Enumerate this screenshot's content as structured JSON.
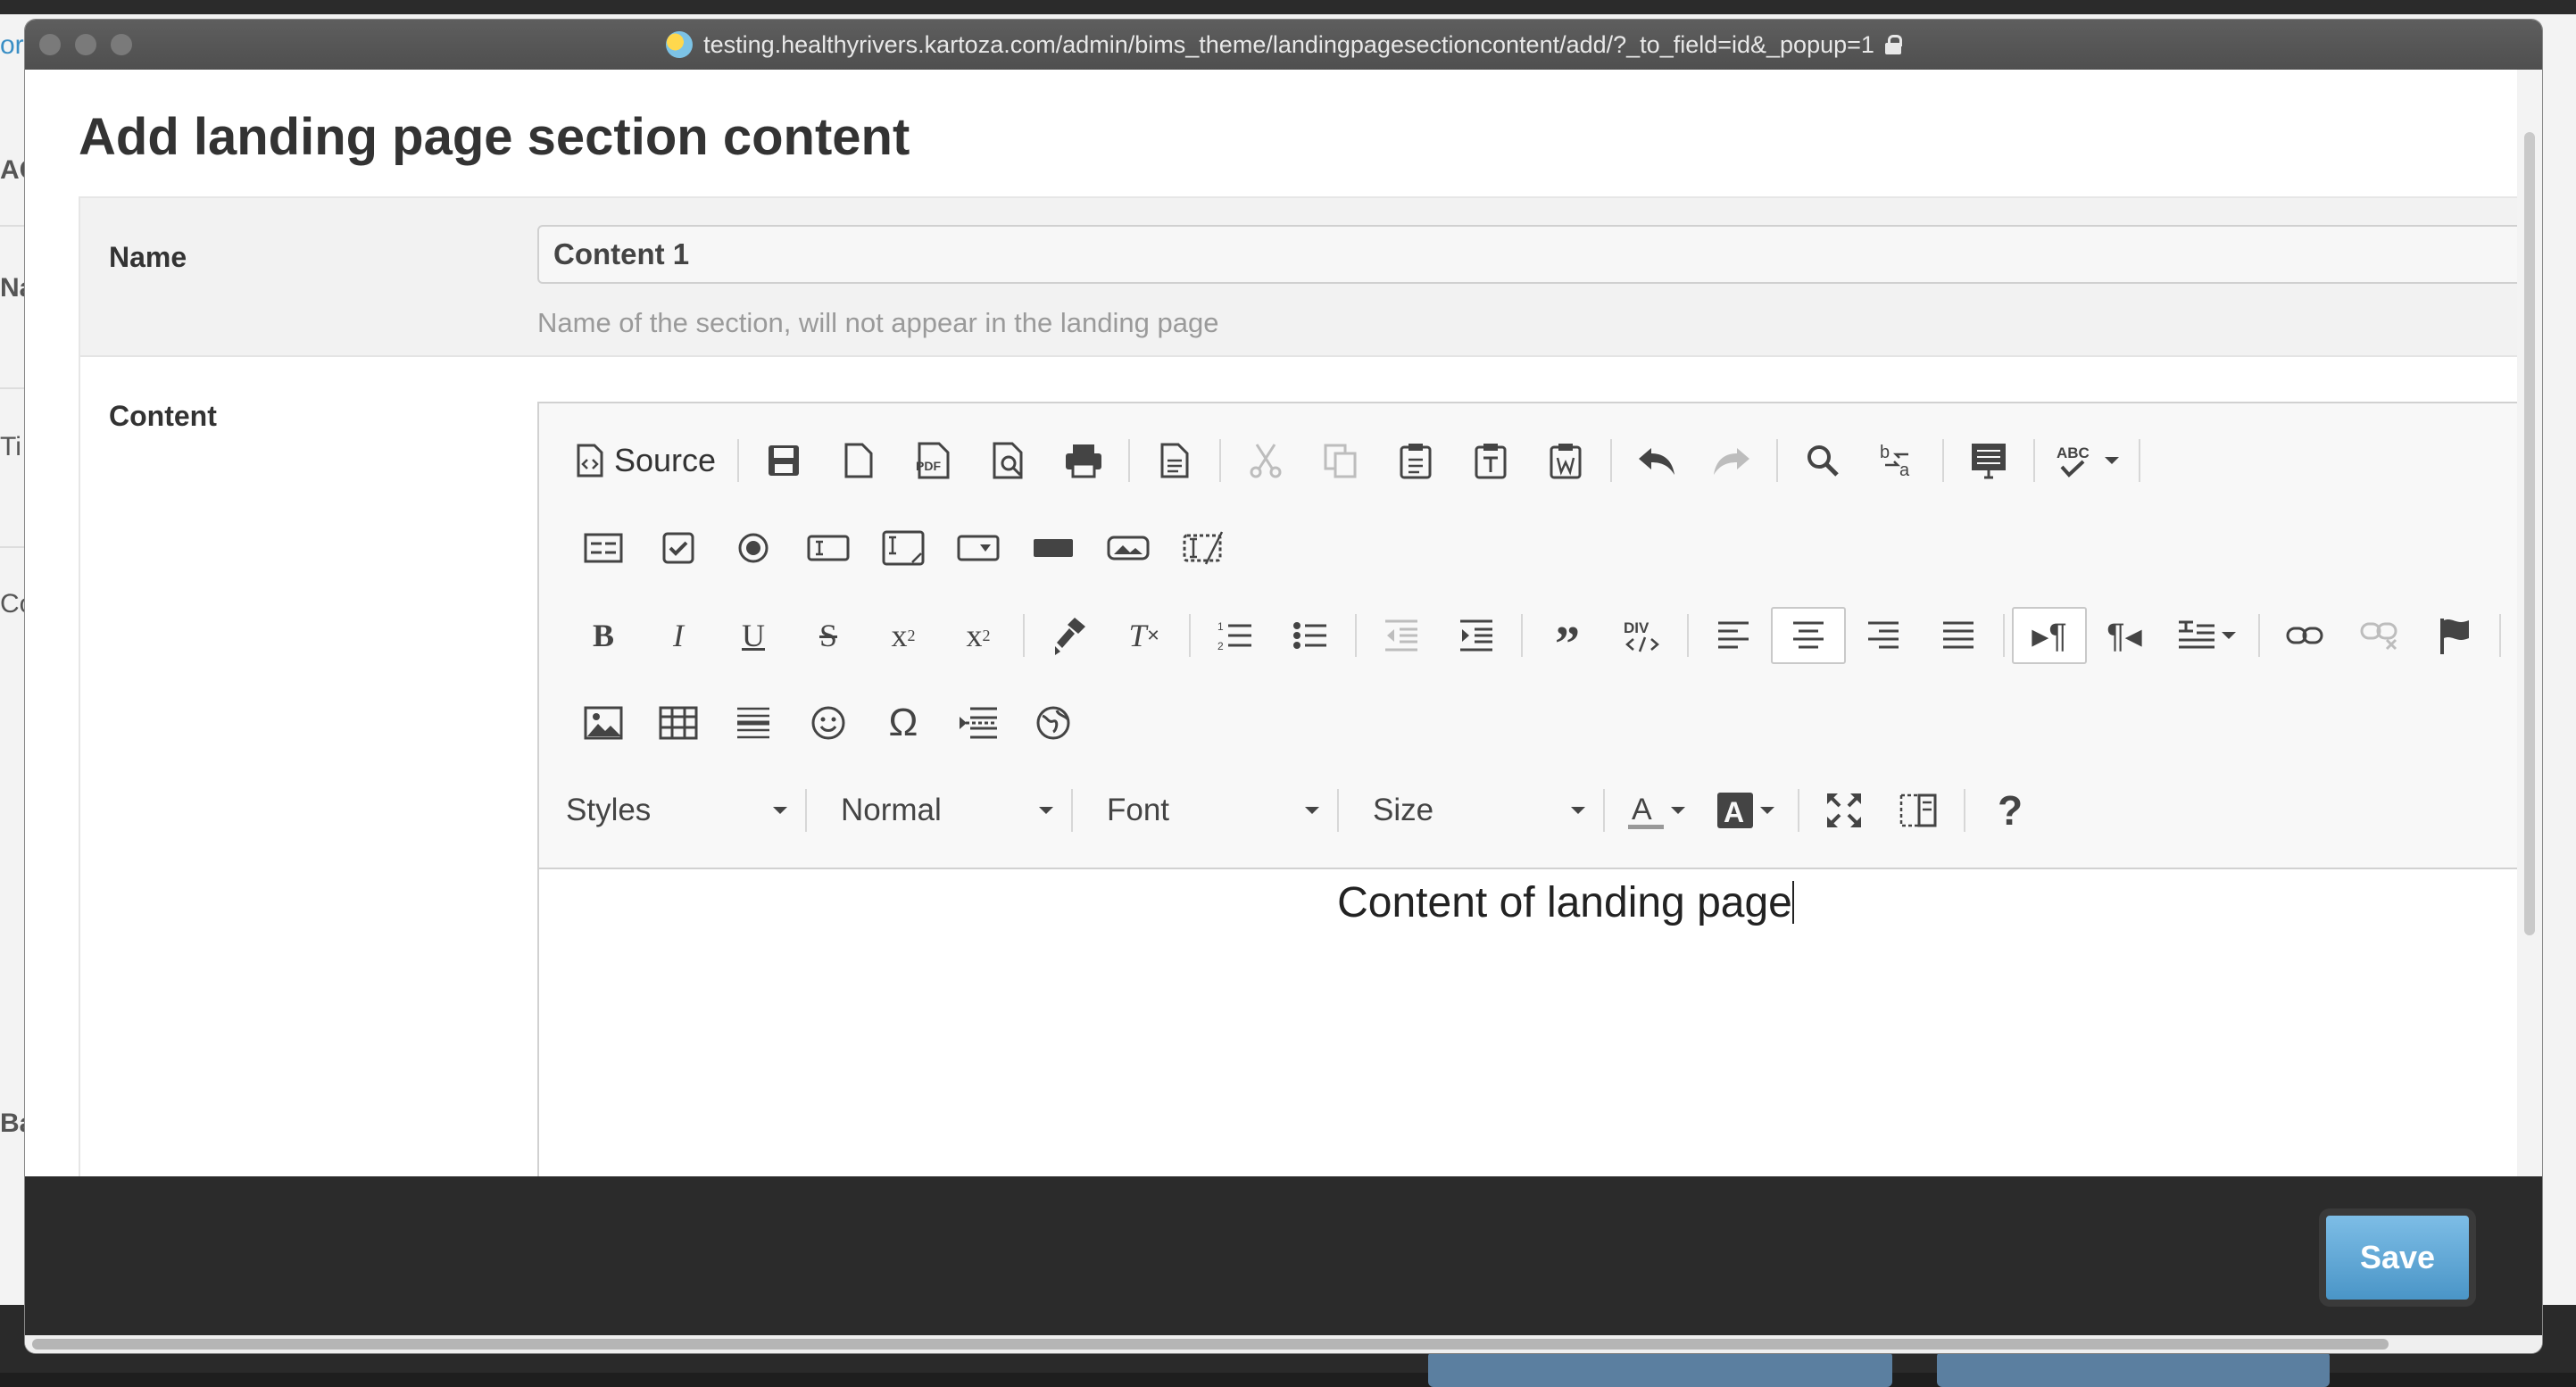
{
  "background_page": {
    "fragments": [
      "or",
      "AC",
      "Na",
      "Ti",
      "Co",
      "Ba"
    ]
  },
  "window": {
    "url": "testing.healthyrivers.kartoza.com/admin/bims_theme/landingpagesectioncontent/add/?_to_field=id&_popup=1"
  },
  "page": {
    "title": "Add landing page section content"
  },
  "form": {
    "name": {
      "label": "Name",
      "value": "Content 1",
      "help": "Name of the section, will not appear in the landing page"
    },
    "content": {
      "label": "Content",
      "text": "Content of landing page"
    }
  },
  "toolbar": {
    "source_label": "Source",
    "styles_label": "Styles",
    "format_label": "Normal",
    "font_label": "Font",
    "size_label": "Size",
    "pdf_label": "PDF",
    "div_label": "DIV",
    "abc_label": "ABC"
  },
  "footer": {
    "save_label": "Save"
  },
  "colors": {
    "save_button": "#4a95c7",
    "footer_bar": "#2b2b2b",
    "titlebar": "#555555"
  }
}
